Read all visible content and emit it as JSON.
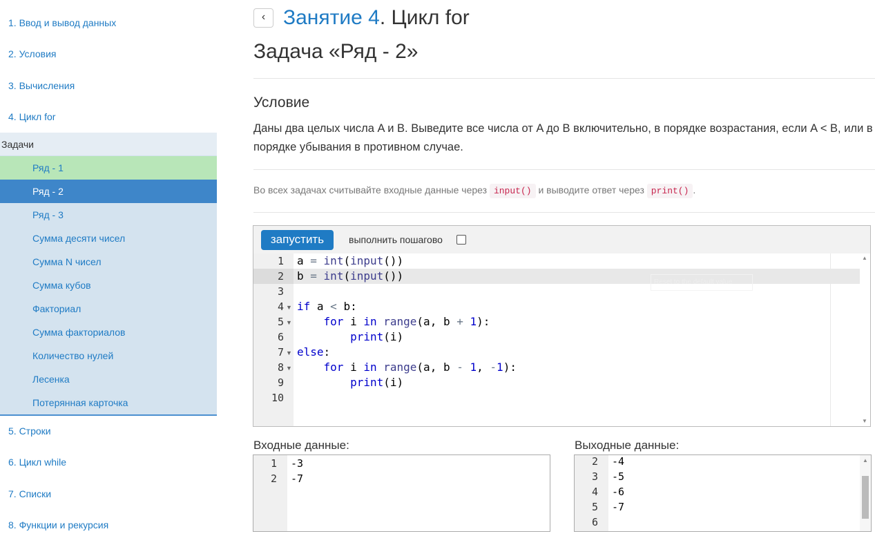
{
  "sidebar": {
    "lessons_top": [
      "1. Ввод и вывод данных",
      "2. Условия",
      "3. Вычисления",
      "4. Цикл for"
    ],
    "tasks_header": "Задачи",
    "tasks": [
      "Ряд - 1",
      "Ряд - 2",
      "Ряд - 3",
      "Сумма десяти чисел",
      "Сумма N чисел",
      "Сумма кубов",
      "Факториал",
      "Сумма факториалов",
      "Количество нулей",
      "Лесенка",
      "Потерянная карточка"
    ],
    "completed_task": "Ряд - 1",
    "active_task": "Ряд - 2",
    "lessons_bottom": [
      "5. Строки",
      "6. Цикл while",
      "7. Списки",
      "8. Функции и рекурсия"
    ]
  },
  "header": {
    "back_icon": "‹",
    "lesson_link": "Занятие 4",
    "lesson_rest": ". Цикл for",
    "task_title": "Задача «Ряд - 2»"
  },
  "condition": {
    "title": "Условие",
    "text": "Даны два целых числа A и B. Выведите все числа от A до B включительно, в порядке возрастания, если A < B, или в порядке убывания в противном случае."
  },
  "io_note": {
    "prefix": "Во всех задачах считывайте входные данные через",
    "input_code": "input()",
    "middle": "и выводите ответ через",
    "print_code": "print()",
    "suffix": "."
  },
  "editor": {
    "run_label": "запустить",
    "step_label": "выполнить пошагово",
    "step_checked": false,
    "line_numbers": [
      "1",
      "2",
      "3",
      "4",
      "5",
      "6",
      "7",
      "8",
      "9",
      "10"
    ],
    "active_line": 2,
    "tooltip_text": "Reset to the default value"
  },
  "input": {
    "label": "Входные данные:",
    "line_numbers": [
      "1",
      "2"
    ],
    "lines": [
      "-3",
      "-7"
    ]
  },
  "output": {
    "label": "Выходные данные:",
    "line_numbers": [
      "2",
      "3",
      "4",
      "5",
      "6"
    ],
    "lines": [
      "-4",
      "-5",
      "-6",
      "-7",
      ""
    ]
  },
  "colors": {
    "link": "#1f7bc4",
    "completed": "#b8e6b8",
    "active": "#3e86c9",
    "tasks_bg": "#d4e3ef",
    "run_button": "#1f7bc4"
  }
}
